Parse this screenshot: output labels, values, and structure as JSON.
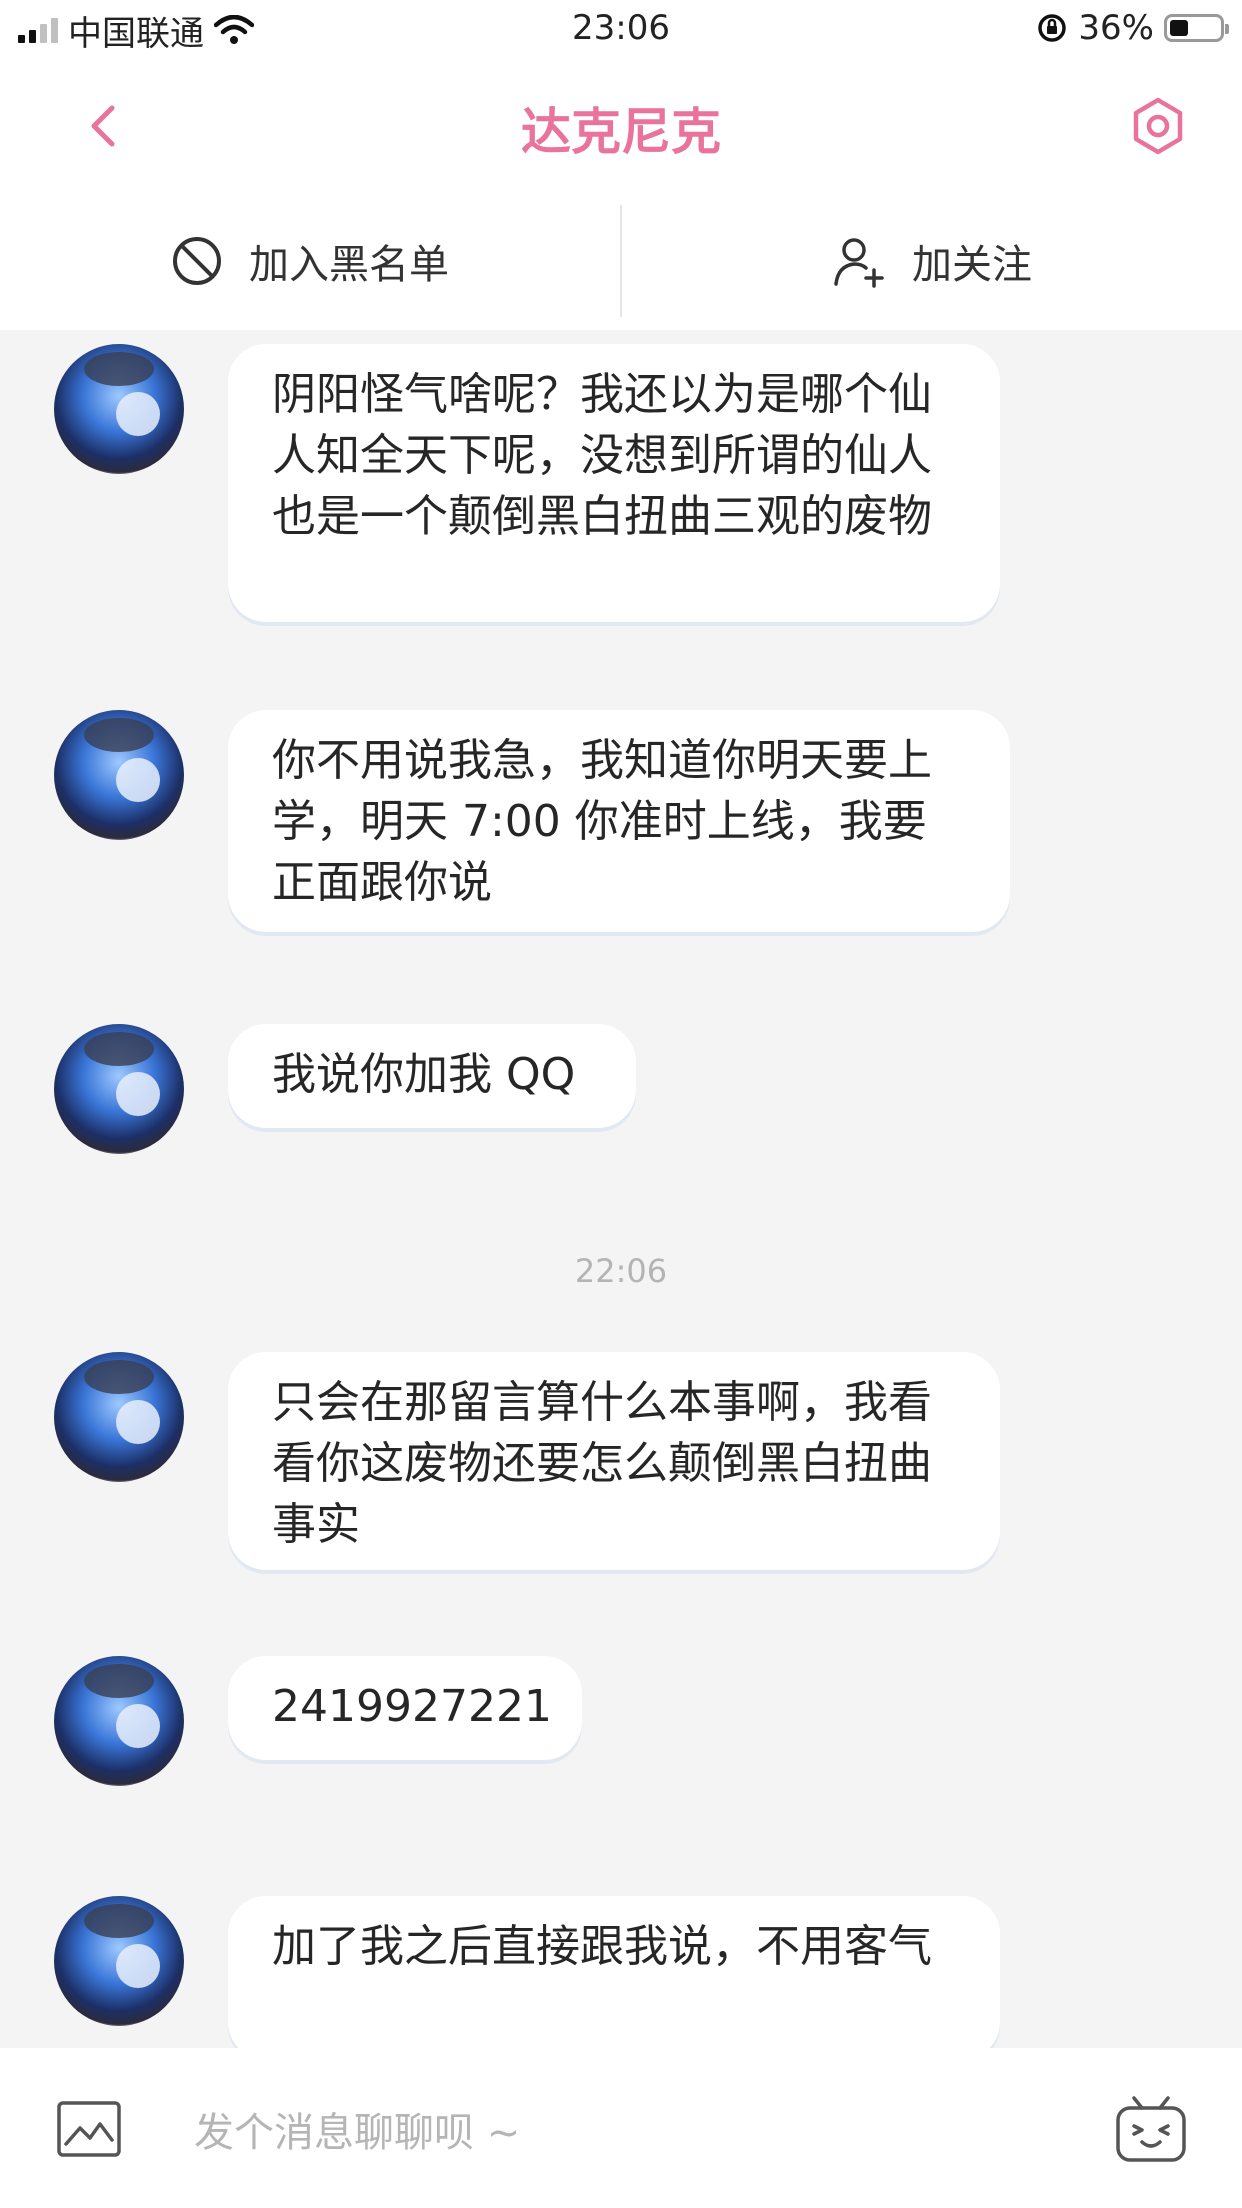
{
  "status_bar": {
    "carrier": "中国联通",
    "time": "23:06",
    "battery": "36%"
  },
  "nav": {
    "title": "达克尼克",
    "back_icon": "chevron-left-icon",
    "settings_icon": "gear-hexagon-icon",
    "accent": "#e9739a"
  },
  "actions": {
    "blacklist_label": "加入黑名单",
    "follow_label": "加关注"
  },
  "messages": [
    {
      "text": "阴阳怪气啥呢？我还以为是哪个仙人知全天下呢，没想到所谓的仙人也是一个颠倒黑白扭曲三观的废物"
    },
    {
      "text": "你不用说我急，我知道你明天要上学，明天 7:00 你准时上线，我要正面跟你说"
    },
    {
      "text": "我说你加我 QQ"
    },
    {
      "text": "只会在那留言算什么本事啊，我看看你这废物还要怎么颠倒黑白扭曲事实"
    },
    {
      "text": "2419927221"
    },
    {
      "text": "加了我之后直接跟我说，不用客气"
    }
  ],
  "timestamp": "22:06",
  "input": {
    "placeholder": "发个消息聊聊呗 ~"
  }
}
